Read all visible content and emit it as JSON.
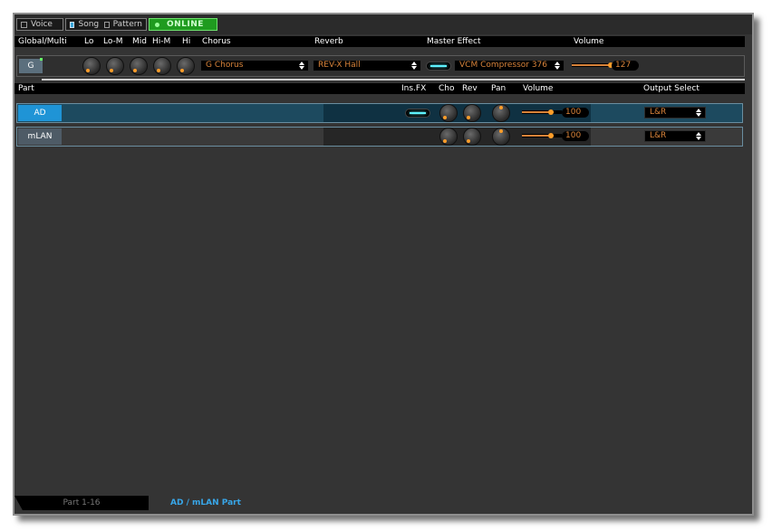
{
  "modes": {
    "voice": "Voice",
    "song": "Song",
    "pattern": "Pattern",
    "online": "ONLINE"
  },
  "global": {
    "header": {
      "label": "Global/Multi",
      "lo": "Lo",
      "lom": "Lo-M",
      "mid": "Mid",
      "him": "Hi-M",
      "hi": "Hi",
      "chorus": "Chorus",
      "reverb": "Reverb",
      "master": "Master Effect",
      "volume": "Volume"
    },
    "row": {
      "button": "G",
      "chorus_value": "G Chorus",
      "reverb_value": "REV-X Hall",
      "master_value": "VCM Compressor 376",
      "volume_value": "127",
      "volume_level": 1.0
    }
  },
  "parts": {
    "header": {
      "part": "Part",
      "insfx": "Ins.FX",
      "cho": "Cho",
      "rev": "Rev",
      "pan": "Pan",
      "volume": "Volume",
      "output": "Output Select"
    },
    "rows": [
      {
        "label": "AD",
        "volume": "100",
        "volume_level": 0.79,
        "output": "L&R"
      },
      {
        "label": "mLAN",
        "volume": "100",
        "volume_level": 0.79,
        "output": "L&R"
      }
    ]
  },
  "tabs": {
    "tab1": "Part 1-16",
    "tab2": "AD / mLAN Part"
  },
  "colors": {
    "accent": "#39a8dc",
    "value_text": "#d8833a",
    "online": "#1f9b1f"
  }
}
